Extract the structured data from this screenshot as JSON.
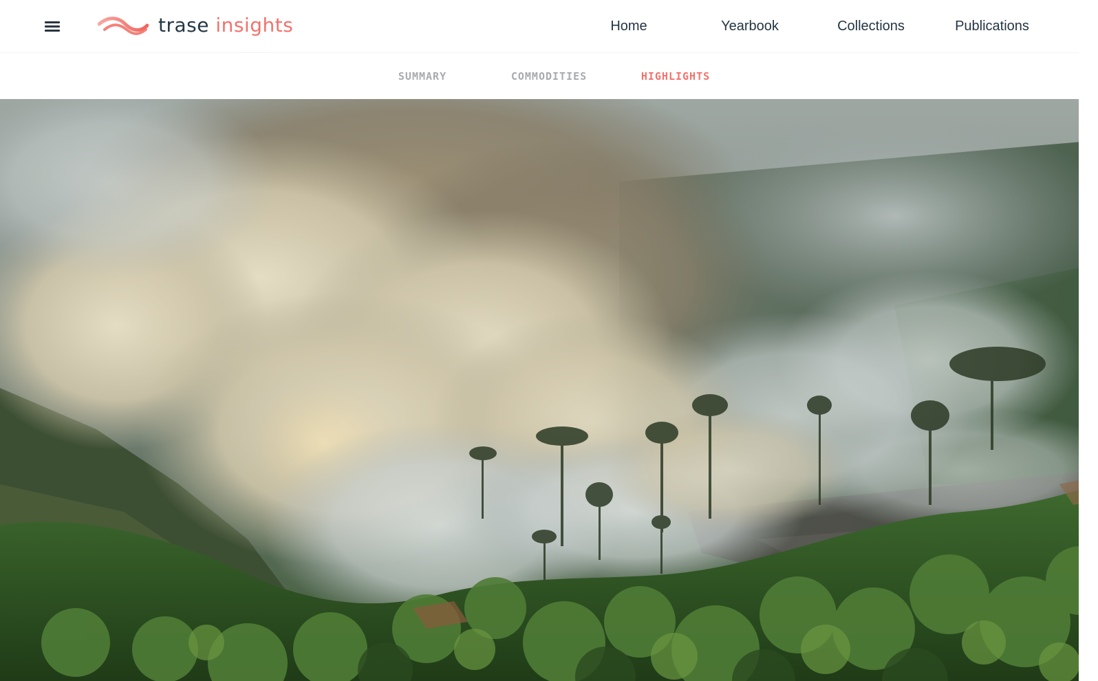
{
  "header": {
    "logo": {
      "word1": "trase",
      "word2": "insights"
    },
    "nav": [
      {
        "label": "Home"
      },
      {
        "label": "Yearbook"
      },
      {
        "label": "Collections"
      },
      {
        "label": "Publications"
      }
    ]
  },
  "subnav": {
    "tabs": [
      {
        "label": "SUMMARY",
        "active": false
      },
      {
        "label": "COMMODITIES",
        "active": false
      },
      {
        "label": "HIGHLIGHTS",
        "active": true
      }
    ]
  },
  "colors": {
    "brand_coral": "#f2726c",
    "brand_navy": "#243746",
    "inactive_tab": "#a8abae"
  },
  "icons": [
    "menu-icon",
    "trase-wave-logo-icon"
  ]
}
